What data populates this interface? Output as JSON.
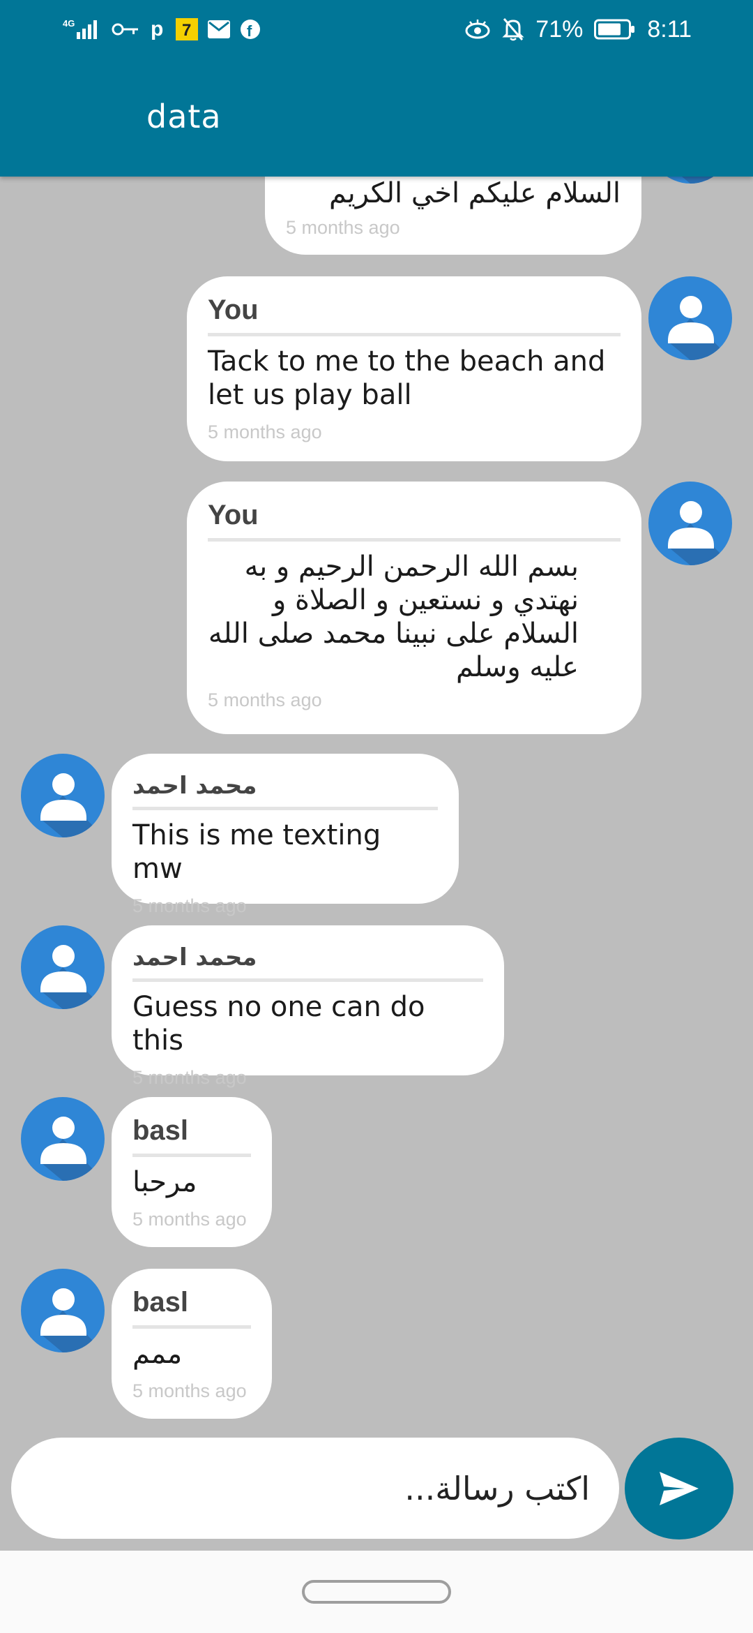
{
  "status_bar": {
    "network": "4G",
    "battery": "71%",
    "time": "8:11"
  },
  "app_bar": {
    "title": "data"
  },
  "messages": [
    {
      "sender": "",
      "text": "السلام عليكم اخي الكريم",
      "time": "5 months ago"
    },
    {
      "sender": "You",
      "text": "Tack to me to the beach and let us play ball",
      "time": "5 months ago"
    },
    {
      "sender": "You",
      "text": "بسم الله الرحمن الرحيم و به نهتدي و نستعين و الصلاة و السلام على نبينا محمد صلى الله عليه وسلم",
      "time": "5 months ago"
    },
    {
      "sender": "محمد احمد",
      "text": "This is me texting mw",
      "time": "5 months ago"
    },
    {
      "sender": "محمد احمد",
      "text": "Guess no one can do this",
      "time": "5 months ago"
    },
    {
      "sender": "basl",
      "text": "مرحبا",
      "time": "5 months ago"
    },
    {
      "sender": "basl",
      "text": "ممم",
      "time": "5 months ago"
    }
  ],
  "composer": {
    "placeholder": "اكتب رسالة..."
  },
  "icons": {
    "send": "send-icon",
    "avatar": "user-avatar-icon",
    "battery": "battery-icon"
  },
  "colors": {
    "primary": "#017697",
    "chat_background": "#bdbdbd",
    "avatar": "#2f86d6",
    "bubble": "#ffffff"
  }
}
